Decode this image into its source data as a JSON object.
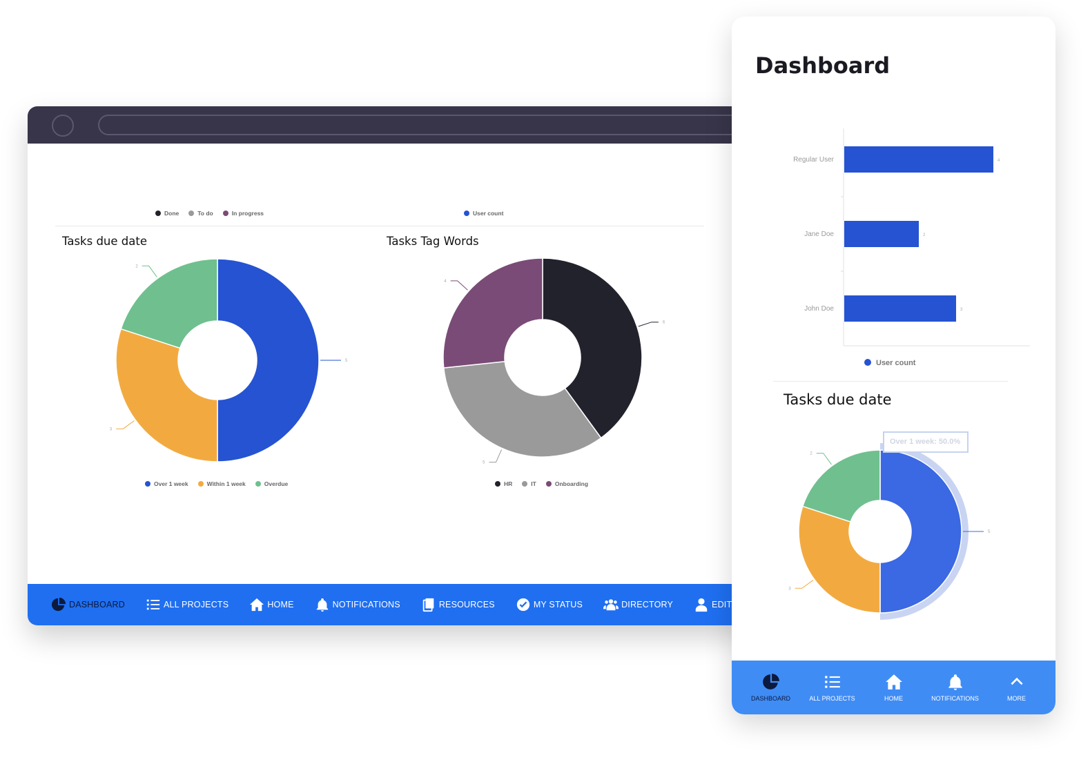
{
  "desktop": {
    "nav": [
      {
        "label": "DASHBOARD",
        "icon": "pie-chart-icon",
        "active": true
      },
      {
        "label": "ALL PROJECTS",
        "icon": "list-icon",
        "active": false
      },
      {
        "label": "HOME",
        "icon": "home-icon",
        "active": false
      },
      {
        "label": "NOTIFICATIONS",
        "icon": "bell-icon",
        "active": false
      },
      {
        "label": "RESOURCES",
        "icon": "documents-icon",
        "active": false
      },
      {
        "label": "MY STATUS",
        "icon": "check-circle-icon",
        "active": false
      },
      {
        "label": "DIRECTORY",
        "icon": "people-icon",
        "active": false
      },
      {
        "label": "EDIT PROFILE",
        "icon": "user-icon",
        "active": false
      }
    ],
    "top_legends": {
      "status": [
        "Done",
        "To do",
        "In progress"
      ],
      "users": [
        "User count"
      ]
    },
    "tasks_due_date": {
      "title": "Tasks due date"
    },
    "tasks_tag_words": {
      "title": "Tasks Tag Words"
    }
  },
  "mobile": {
    "title": "Dashboard",
    "tasks_due_date_title": "Tasks due date",
    "tooltip": "Over 1 week: 50.0%",
    "user_legend": "User count",
    "nav": [
      {
        "label": "DASHBOARD",
        "icon": "pie-chart-icon",
        "active": true
      },
      {
        "label": "ALL PROJECTS",
        "icon": "list-icon",
        "active": false
      },
      {
        "label": "HOME",
        "icon": "home-icon",
        "active": false
      },
      {
        "label": "NOTIFICATIONS",
        "icon": "bell-icon",
        "active": false
      },
      {
        "label": "MORE",
        "icon": "chevron-up-icon",
        "active": false
      }
    ]
  },
  "colors": {
    "blue": "#2553d1",
    "orange": "#f2aa40",
    "green": "#6fc08e",
    "black": "#22222c",
    "gray": "#9a9a9a",
    "purple": "#7a4b76",
    "nav_blue": "#1f6ff0",
    "mobile_nav_blue": "#3f8cf5"
  },
  "chart_data": [
    {
      "id": "desktop-tasks-due-date",
      "type": "pie",
      "title": "Tasks due date",
      "labels": [
        "Over 1 week",
        "Within 1 week",
        "Overdue"
      ],
      "values": [
        5,
        3,
        2
      ],
      "value_labels": [
        "5",
        "3",
        "2"
      ],
      "colors": [
        "#2553d1",
        "#f2aa40",
        "#6fc08e"
      ],
      "legend": "bottom"
    },
    {
      "id": "desktop-tasks-tag-words",
      "type": "pie",
      "title": "Tasks Tag Words",
      "labels": [
        "HR",
        "IT",
        "Onboarding"
      ],
      "values": [
        6,
        5,
        4
      ],
      "value_labels": [
        "6",
        "5",
        "4"
      ],
      "colors": [
        "#22222c",
        "#9a9a9a",
        "#7a4b76"
      ],
      "legend": "bottom"
    },
    {
      "id": "mobile-user-count",
      "type": "bar",
      "orientation": "horizontal",
      "categories": [
        "Regular User",
        "Jane Doe",
        "John Doe"
      ],
      "series": [
        {
          "name": "User count",
          "values": [
            4,
            2,
            3
          ]
        }
      ],
      "value_labels": [
        "4",
        "2",
        "3"
      ],
      "colors": [
        "#2553d1"
      ],
      "legend": "bottom"
    },
    {
      "id": "mobile-tasks-due-date",
      "type": "pie",
      "title": "Tasks due date",
      "labels": [
        "Over 1 week",
        "Within 1 week",
        "Overdue"
      ],
      "values": [
        5,
        3,
        2
      ],
      "value_labels": [
        "5",
        "3",
        "2"
      ],
      "colors": [
        "#3b68e3",
        "#f2aa40",
        "#6fc08e"
      ],
      "highlighted": "Over 1 week"
    }
  ]
}
